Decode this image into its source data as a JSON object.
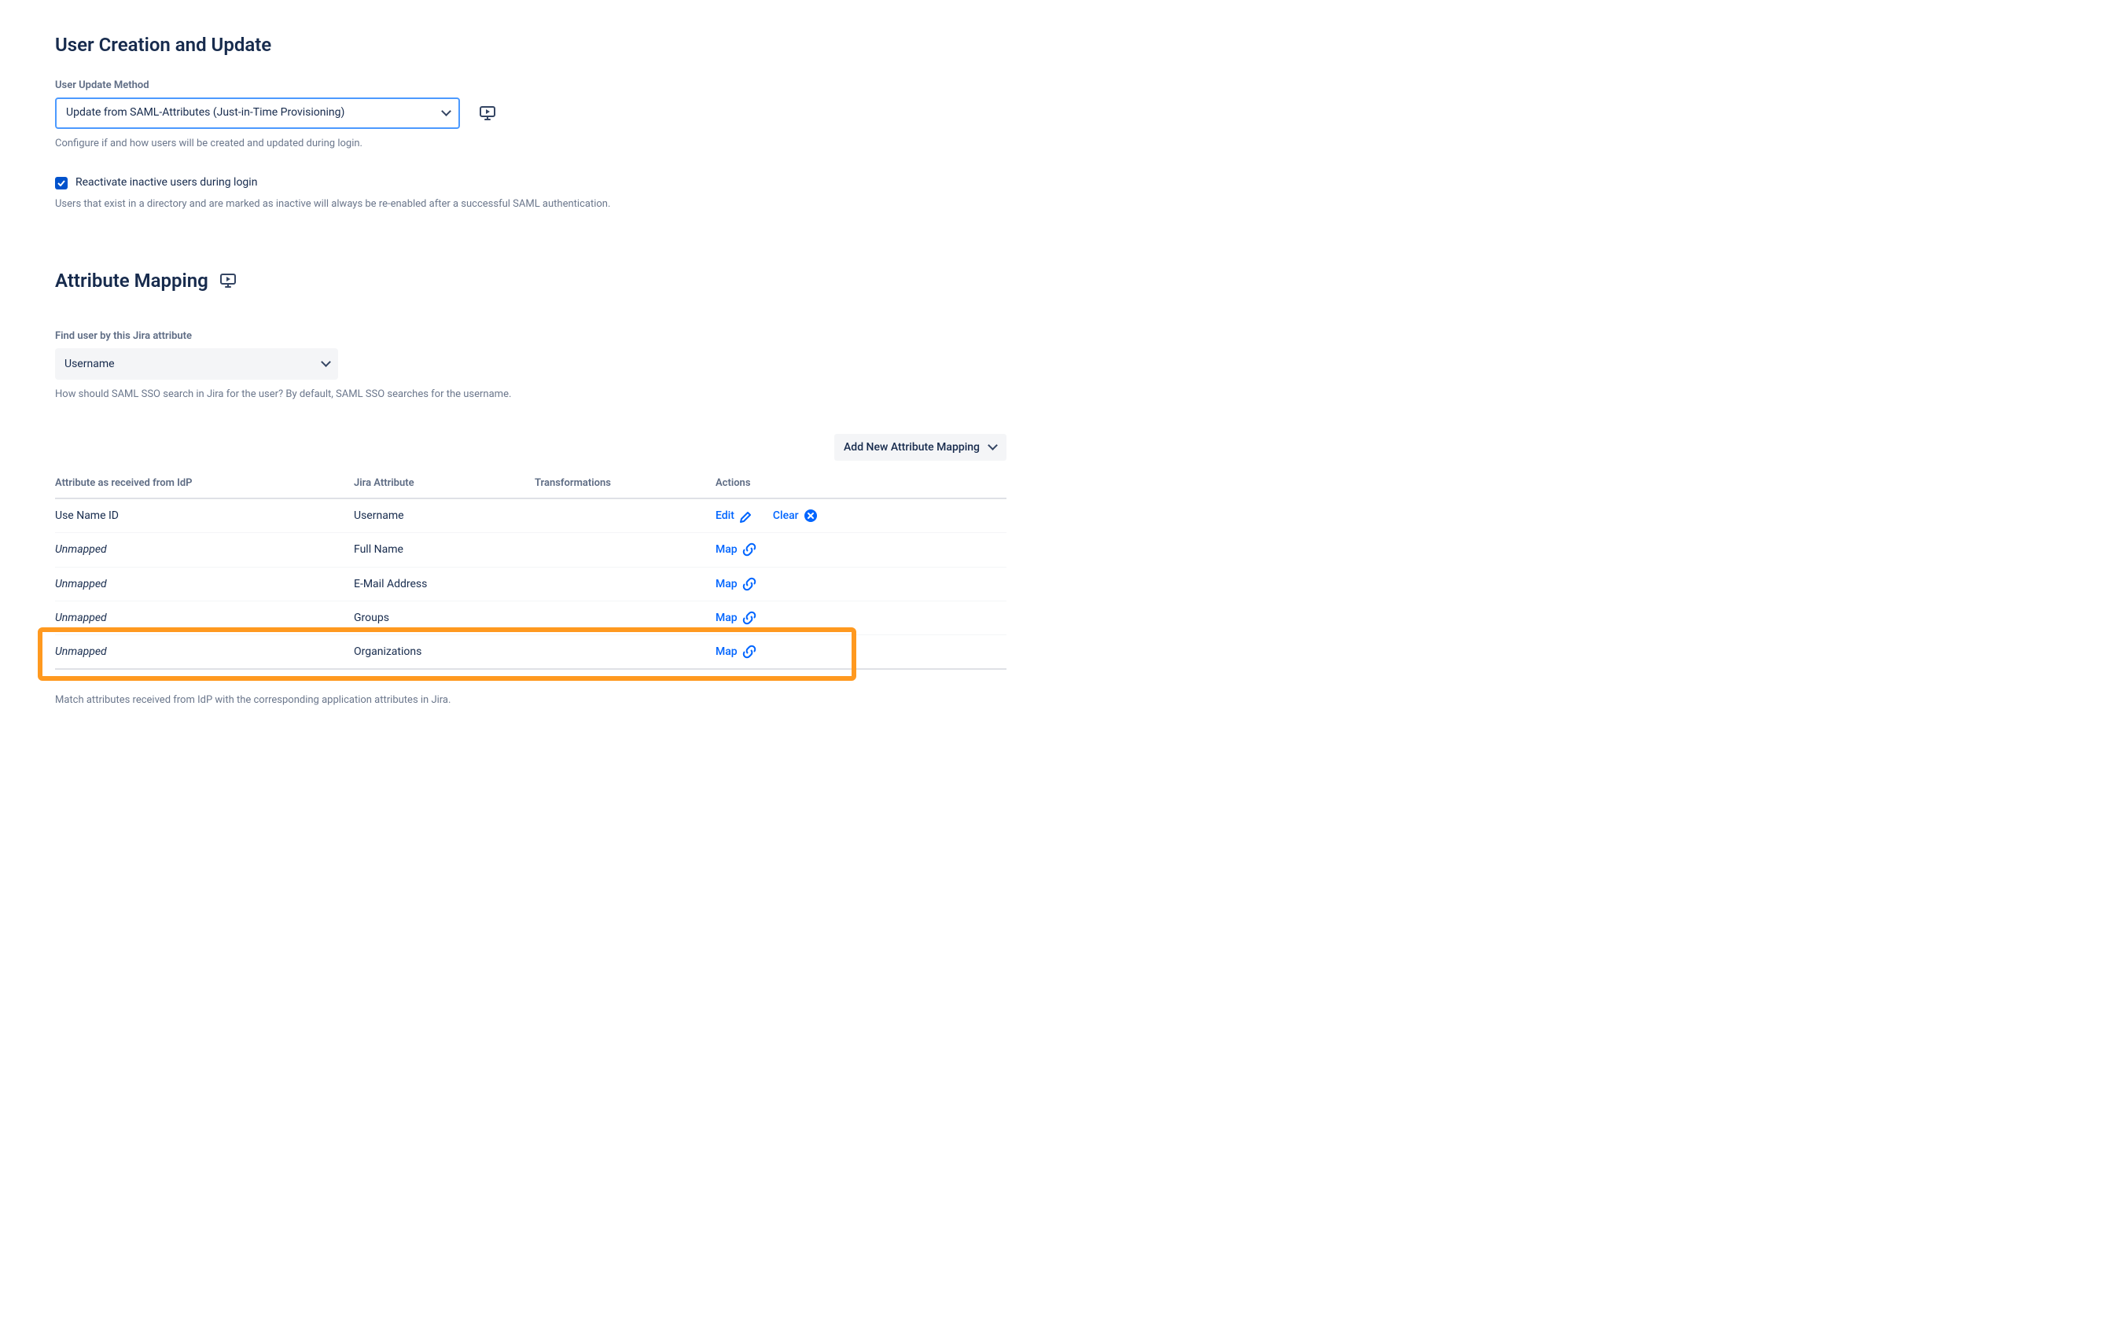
{
  "section1": {
    "title": "User Creation and Update",
    "update_method": {
      "label": "User Update Method",
      "value": "Update from SAML-Attributes (Just-in-Time Provisioning)",
      "help": "Configure if and how users will be created and updated during login."
    },
    "reactivate": {
      "label": "Reactivate inactive users during login",
      "help": "Users that exist in a directory and are marked as inactive will always be re-enabled after a successful SAML authentication."
    }
  },
  "section2": {
    "title": "Attribute Mapping",
    "find_user": {
      "label": "Find user by this Jira attribute",
      "value": "Username",
      "help": "How should SAML SSO search in Jira for the user? By default, SAML SSO searches for the username."
    },
    "add_button": "Add New Attribute Mapping",
    "columns": {
      "idp": "Attribute as received from IdP",
      "jira": "Jira Attribute",
      "transformations": "Transformations",
      "actions": "Actions"
    },
    "rows": [
      {
        "idp": "Use Name ID",
        "jira": "Username",
        "actions": [
          "edit",
          "clear"
        ]
      },
      {
        "idp": "Unmapped",
        "jira": "Full Name",
        "actions": [
          "map"
        ],
        "italic": true
      },
      {
        "idp": "Unmapped",
        "jira": "E-Mail Address",
        "actions": [
          "map"
        ],
        "italic": true
      },
      {
        "idp": "Unmapped",
        "jira": "Groups",
        "actions": [
          "map"
        ],
        "italic": true
      },
      {
        "idp": "Unmapped",
        "jira": "Organizations",
        "actions": [
          "map"
        ],
        "italic": true,
        "highlighted": true
      }
    ],
    "action_labels": {
      "edit": "Edit",
      "clear": "Clear",
      "map": "Map"
    },
    "footer_help": "Match attributes received from IdP with the corresponding application attributes in Jira."
  }
}
